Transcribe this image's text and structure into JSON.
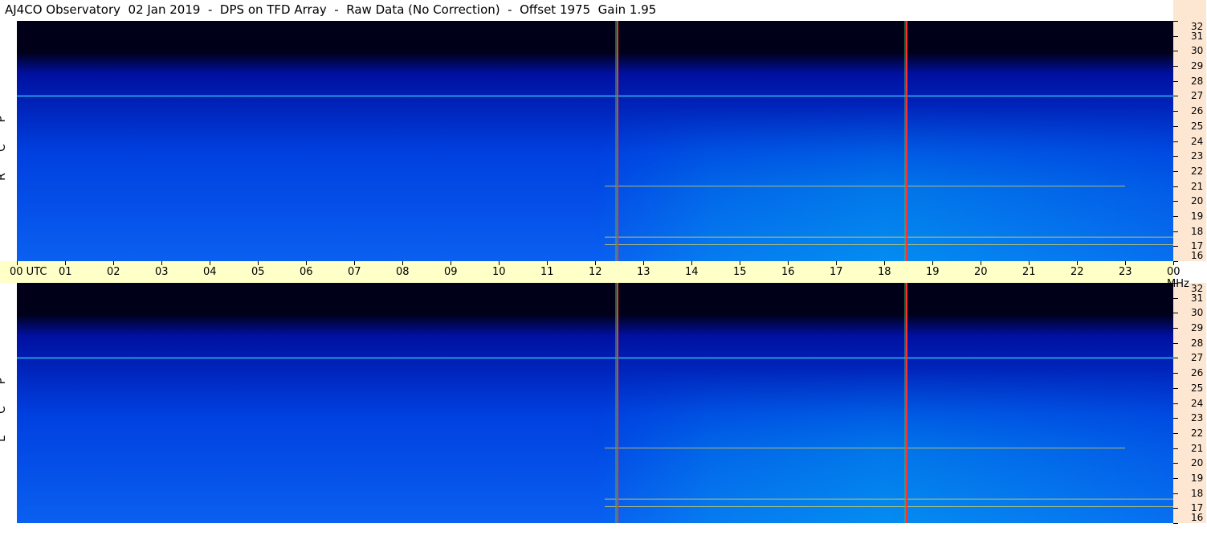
{
  "title": "AJ4CO Observatory  02 Jan 2019  -  DPS on TFD Array  -  Raw Data (No Correction)  -  Offset 1975  Gain 1.95",
  "time_axis": {
    "labels": [
      "00",
      "01",
      "02",
      "03",
      "04",
      "05",
      "06",
      "07",
      "08",
      "09",
      "10",
      "11",
      "12",
      "13",
      "14",
      "15",
      "16",
      "17",
      "18",
      "19",
      "20",
      "21",
      "22",
      "23",
      "00"
    ],
    "first_unit": "UTC",
    "last_unit": "MHz"
  },
  "freq_axis": {
    "labels": [
      "16",
      "17",
      "18",
      "19",
      "20",
      "21",
      "22",
      "23",
      "24",
      "25",
      "26",
      "27",
      "28",
      "29",
      "30",
      "31",
      "32"
    ]
  },
  "panels": [
    {
      "key": "rcp",
      "label_letters": [
        "P",
        "C",
        "R"
      ]
    },
    {
      "key": "lcp",
      "label_letters": [
        "P",
        "C",
        "L"
      ]
    }
  ],
  "colors": {
    "background": "#ffffff",
    "freq_scale_bg": "#fde7d2",
    "time_axis_bg": "#ffffc8",
    "spectrogram_dark": "#000018",
    "spectrogram_deep_blue": "#0010a0",
    "spectrogram_blue": "#0040e0",
    "spectrogram_cyan": "#00b0f0",
    "marker_red": "#ff3030",
    "marker_green": "#30c060"
  },
  "chart_data": {
    "type": "heatmap",
    "title": "AJ4CO Observatory  02 Jan 2019  -  DPS on TFD Array  -  Raw Data (No Correction)  -  Offset 1975  Gain 1.95",
    "x_labels": [
      "00",
      "01",
      "02",
      "03",
      "04",
      "05",
      "06",
      "07",
      "08",
      "09",
      "10",
      "11",
      "12",
      "13",
      "14",
      "15",
      "16",
      "17",
      "18",
      "19",
      "20",
      "21",
      "22",
      "23",
      "00"
    ],
    "x_unit": "UTC",
    "y_labels": [
      "16",
      "17",
      "18",
      "19",
      "20",
      "21",
      "22",
      "23",
      "24",
      "25",
      "26",
      "27",
      "28",
      "29",
      "30",
      "31",
      "32"
    ],
    "y_unit": "MHz",
    "xlim": [
      0,
      24
    ],
    "ylim": [
      16,
      32
    ],
    "series": [
      {
        "name": "RCP",
        "panel_label": "R C P"
      },
      {
        "name": "LCP",
        "panel_label": "L C P"
      }
    ],
    "markers_utc": [
      12.45,
      18.45
    ],
    "persistent_signals_mhz": [
      27.0,
      17.6,
      17.1,
      21.0
    ]
  }
}
